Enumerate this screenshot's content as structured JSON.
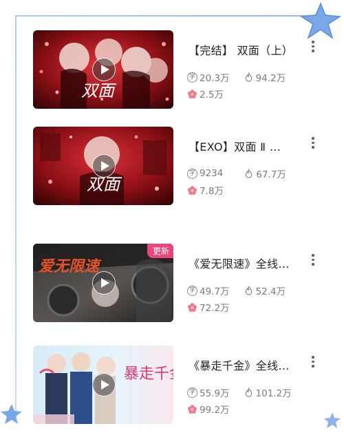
{
  "items": [
    {
      "title": "【完结】 双面（上）",
      "words": "20.3万",
      "heat": "94.2万",
      "likes": "2.5万",
      "cover_text": "双面",
      "cover_colors": [
        "#7a0f14",
        "#c9282d",
        "#f0d6d0"
      ]
    },
    {
      "title": "【EXO】双面 Ⅱ …",
      "words": "9234",
      "heat": "67.7万",
      "likes": "7.8万",
      "cover_text": "双面",
      "cover_colors": [
        "#6e0d12",
        "#c52a30",
        "#e9c8c2"
      ]
    },
    {
      "title": "《爱无限速》全线…",
      "words": "49.7万",
      "heat": "52.4万",
      "likes": "72.2万",
      "cover_text": "爱无限速",
      "badge": "更新",
      "cover_colors": [
        "#2b2b2b",
        "#e04a24",
        "#c7c0bb"
      ]
    },
    {
      "title": "《暴走千金》全线…",
      "words": "55.9万",
      "heat": "101.2万",
      "likes": "99.2万",
      "cover_text": "暴走千金",
      "cover_colors": [
        "#cfe6f5",
        "#e54b7c",
        "#fbe7ee"
      ]
    }
  ],
  "icons": {
    "words": "zi-character-icon",
    "heat": "flame-icon",
    "likes": "flower-icon",
    "more": "more-vertical-icon",
    "play": "play-icon"
  },
  "labels": {
    "zi": "字"
  },
  "colors": {
    "frame": "#a9c7f0",
    "star": "#6f9fe6",
    "title_text": "#222222",
    "stat_text": "#7a7a7a",
    "flower": "#f07a8a",
    "badge": "#e9467c"
  }
}
